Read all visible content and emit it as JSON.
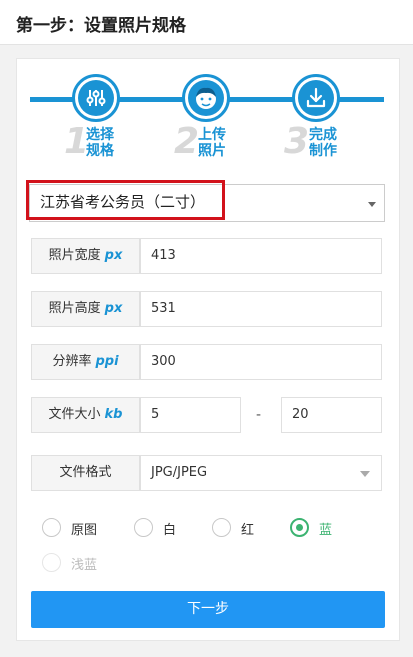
{
  "header": {
    "title": "第一步：设置照片规格"
  },
  "steps": [
    {
      "number": "1",
      "label_line1": "选择",
      "label_line2": "规格",
      "icon": "sliders-icon"
    },
    {
      "number": "2",
      "label_line1": "上传",
      "label_line2": "照片",
      "icon": "face-icon"
    },
    {
      "number": "3",
      "label_line1": "完成",
      "label_line2": "制作",
      "icon": "download-icon"
    }
  ],
  "spec": {
    "selected": "江苏省考公务员（二寸）"
  },
  "fields": {
    "width": {
      "label": "照片宽度",
      "unit": "px",
      "value": "413"
    },
    "height": {
      "label": "照片高度",
      "unit": "px",
      "value": "531"
    },
    "resolution": {
      "label": "分辨率",
      "unit": "ppi",
      "value": "300"
    },
    "filesize": {
      "label": "文件大小",
      "unit": "kb",
      "min": "5",
      "separator": "-",
      "max": "20"
    },
    "format": {
      "label": "文件格式",
      "value": "JPG/JPEG"
    }
  },
  "background_options": [
    {
      "label": "原图",
      "state": "unchecked"
    },
    {
      "label": "白",
      "state": "unchecked"
    },
    {
      "label": "红",
      "state": "unchecked"
    },
    {
      "label": "蓝",
      "state": "checked"
    },
    {
      "label": "浅蓝",
      "state": "disabled"
    }
  ],
  "next_button": {
    "label": "下一步"
  },
  "colors": {
    "accent": "#1a93d4",
    "button": "#2196f3",
    "highlight": "#d2121b",
    "checked": "#3cb371"
  }
}
